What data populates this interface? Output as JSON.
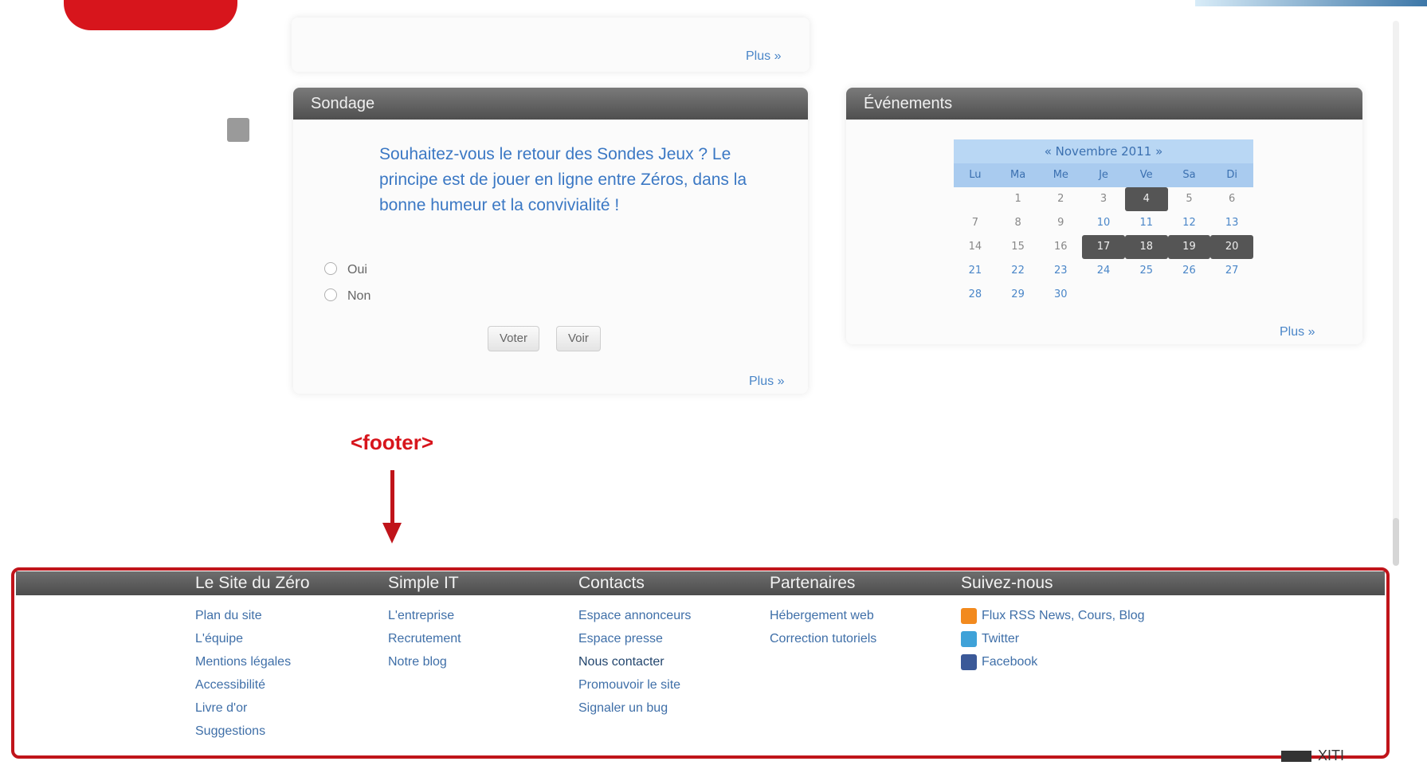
{
  "top_box": {
    "more": "Plus"
  },
  "poll": {
    "title": "Sondage",
    "question": "Souhaitez-vous le retour des Sondes Jeux ? Le principe est de jouer en ligne entre Zéros, dans la bonne humeur et la convivialité !",
    "options": [
      "Oui",
      "Non"
    ],
    "vote_button": "Voter",
    "results_button": "Voir",
    "more": "Plus"
  },
  "calendar": {
    "title": "Événements",
    "month": "« Novembre 2011 »",
    "weekdays": [
      "Lu",
      "Ma",
      "Me",
      "Je",
      "Ve",
      "Sa",
      "Di"
    ],
    "weeks": [
      [
        "",
        "1",
        "2",
        "3",
        "4",
        "5",
        "6"
      ],
      [
        "7",
        "8",
        "9",
        "10",
        "11",
        "12",
        "13"
      ],
      [
        "14",
        "15",
        "16",
        "17",
        "18",
        "19",
        "20"
      ],
      [
        "21",
        "22",
        "23",
        "24",
        "25",
        "26",
        "27"
      ],
      [
        "28",
        "29",
        "30",
        "",
        "",
        "",
        ""
      ]
    ],
    "more": "Plus"
  },
  "annotation": {
    "label": "<footer>"
  },
  "footer": {
    "columns": [
      {
        "title": "Le Site du Zéro",
        "links": [
          "Plan du site",
          "L'équipe",
          "Mentions légales",
          "Accessibilité",
          "Livre d'or",
          "Suggestions"
        ]
      },
      {
        "title": "Simple IT",
        "links": [
          "L'entreprise",
          "Recrutement",
          "Notre blog"
        ]
      },
      {
        "title": "Contacts",
        "links": [
          "Espace annonceurs",
          "Espace presse",
          "Nous contacter",
          "Promouvoir le site",
          "Signaler un bug"
        ]
      },
      {
        "title": "Partenaires",
        "links": [
          "Hébergement web",
          "Correction tutoriels"
        ]
      },
      {
        "title": "Suivez-nous",
        "links": [
          "Flux RSS News, Cours, Blog",
          "Twitter",
          "Facebook"
        ]
      }
    ],
    "stats_label": "XITI"
  },
  "colors": {
    "brand_red": "#d7151c",
    "link_blue": "#3b78c4",
    "header_gray": "#5a5a5a"
  }
}
